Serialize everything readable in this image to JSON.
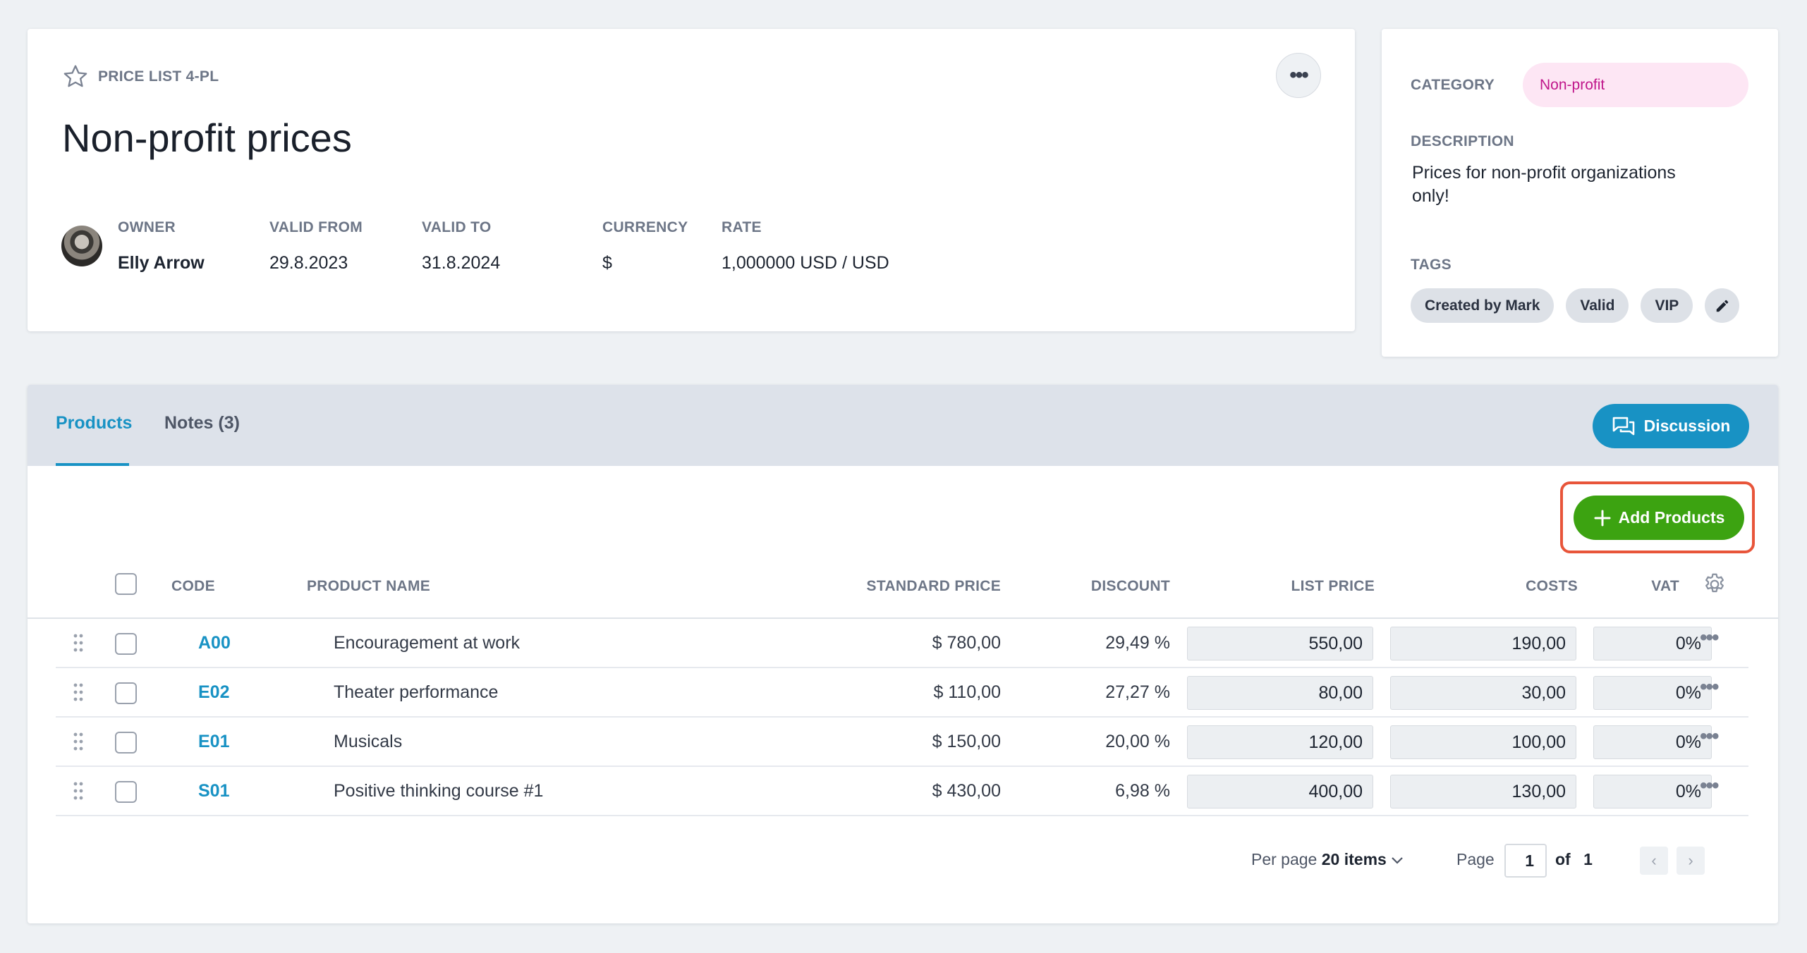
{
  "header": {
    "price_list_label": "PRICE LIST 4-PL",
    "title": "Non-profit prices",
    "more_label": "•••",
    "fields": [
      {
        "key": "OWNER",
        "value": "Elly Arrow"
      },
      {
        "key": "VALID FROM",
        "value": "29.8.2023"
      },
      {
        "key": "VALID TO",
        "value": "31.8.2024"
      },
      {
        "key": "CURRENCY",
        "value": "$"
      },
      {
        "key": "RATE",
        "value": "1,000000 USD / USD"
      }
    ]
  },
  "side": {
    "category_label": "CATEGORY",
    "category_value": "Non-profit",
    "category_color": "#c0168b",
    "description_label": "DESCRIPTION",
    "description_value": "Prices for non-profit organizations only!",
    "tags_label": "TAGS",
    "tags": [
      "Created by Mark",
      "Valid",
      "VIP"
    ]
  },
  "tabs": [
    {
      "label": "Products",
      "active": true
    },
    {
      "label": "Notes (3)",
      "active": false
    }
  ],
  "discussion_label": "Discussion",
  "add_products_label": "Add Products",
  "table": {
    "headers": {
      "code": "CODE",
      "name": "PRODUCT NAME",
      "standard_price": "STANDARD PRICE",
      "discount": "DISCOUNT",
      "list_price": "LIST PRICE",
      "costs": "COSTS",
      "vat": "VAT"
    },
    "rows": [
      {
        "code": "A00",
        "name": "Encouragement at work",
        "standard_price": "$ 780,00",
        "discount": "29,49 %",
        "list_price": "550,00",
        "costs": "190,00",
        "vat": "0%"
      },
      {
        "code": "E02",
        "name": "Theater performance",
        "standard_price": "$ 110,00",
        "discount": "27,27 %",
        "list_price": "80,00",
        "costs": "30,00",
        "vat": "0%"
      },
      {
        "code": "E01",
        "name": "Musicals",
        "standard_price": "$ 150,00",
        "discount": "20,00 %",
        "list_price": "120,00",
        "costs": "100,00",
        "vat": "0%"
      },
      {
        "code": "S01",
        "name": "Positive thinking course #1",
        "standard_price": "$ 430,00",
        "discount": "6,98 %",
        "list_price": "400,00",
        "costs": "130,00",
        "vat": "0%"
      }
    ],
    "row_more_label": "•••"
  },
  "pagination": {
    "per_page_label": "Per page",
    "per_page_value": "20 items",
    "page_label": "Page",
    "page_value": "1",
    "of_label": "of",
    "total_pages": "1"
  },
  "colors": {
    "accent": "#1892c4",
    "add_button": "#3ca311",
    "highlight_frame": "#e8553a"
  }
}
